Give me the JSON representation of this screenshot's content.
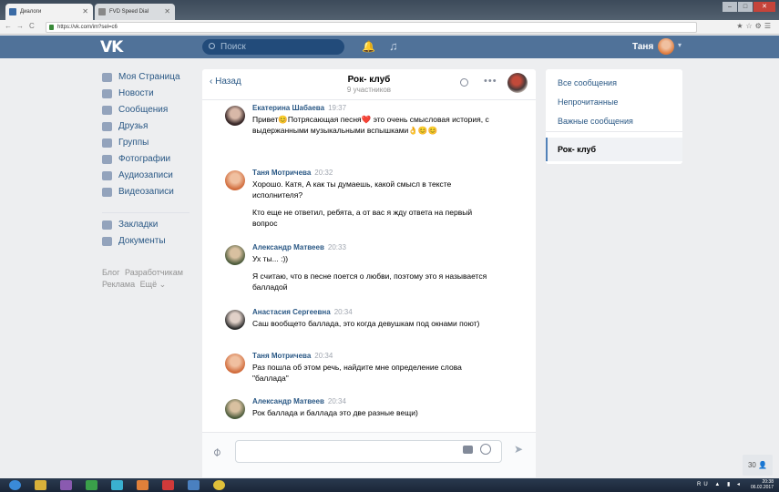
{
  "browser": {
    "tabs": [
      {
        "label": "Диалоги"
      },
      {
        "label": "FVD Speed Dial"
      }
    ],
    "url": "https://vk.com/im?sel=c6"
  },
  "header": {
    "logo": "VK",
    "search_placeholder": "Поиск",
    "user_name": "Таня"
  },
  "sidebar": {
    "items": [
      {
        "label": "Моя Страница",
        "icon": "home-icon"
      },
      {
        "label": "Новости",
        "icon": "news-icon"
      },
      {
        "label": "Сообщения",
        "icon": "messages-icon"
      },
      {
        "label": "Друзья",
        "icon": "friends-icon"
      },
      {
        "label": "Группы",
        "icon": "groups-icon"
      },
      {
        "label": "Фотографии",
        "icon": "photos-icon"
      },
      {
        "label": "Аудиозаписи",
        "icon": "audio-icon"
      },
      {
        "label": "Видеозаписи",
        "icon": "video-icon"
      },
      {
        "label": "Закладки",
        "icon": "bookmarks-icon"
      },
      {
        "label": "Документы",
        "icon": "documents-icon"
      }
    ],
    "footer": [
      "Блог",
      "Разработчикам",
      "Реклама",
      "Ещё"
    ]
  },
  "chat": {
    "back_label": "Назад",
    "title": "Рок- клуб",
    "subtitle": "9 участников",
    "messages": [
      {
        "author": "Екатерина Шабаева",
        "time": "19:37",
        "text": "Привет😊Потрясающая песня❤️ это очень смысловая история, с выдержанными музыкальными вспышками👌😊😊"
      },
      {
        "author": "Таня Мотричева",
        "time": "20:32",
        "text": "Хорошо. Катя, А как ты думаешь, какой смысл в тексте исполнителя?"
      },
      {
        "author": "",
        "time": "",
        "text": "Кто еще не ответил, ребята, а от вас я жду ответа на первый вопрос"
      },
      {
        "author": "Александр Матвеев",
        "time": "20:33",
        "text": "Ух ты... :))"
      },
      {
        "author": "",
        "time": "",
        "text": "Я считаю, что в песне поется о любви, поэтому это я называется балладой"
      },
      {
        "author": "Анастасия Сергеевна",
        "time": "20:34",
        "text": "Саш вообщето баллада, это когда девушкам под окнами поют)"
      },
      {
        "author": "Таня Мотричева",
        "time": "20:34",
        "text": "Раз пошла об этом речь, найдите мне определение слова \"баллада\""
      },
      {
        "author": "Александр Матвеев",
        "time": "20:34",
        "text": "Рок баллада и баллада это две разные вещи)"
      }
    ]
  },
  "right_panel": {
    "all": "Все сообщения",
    "unread": "Непрочитанные",
    "important": "Важные сообщения",
    "active_chat": "Рок- клуб"
  },
  "online_count": "30",
  "tray": {
    "lang": "RU",
    "time": "20:38",
    "date": "06.02.2017"
  },
  "colors": {
    "vk_blue": "#507299",
    "link": "#2a5885",
    "bg": "#edeef0"
  }
}
